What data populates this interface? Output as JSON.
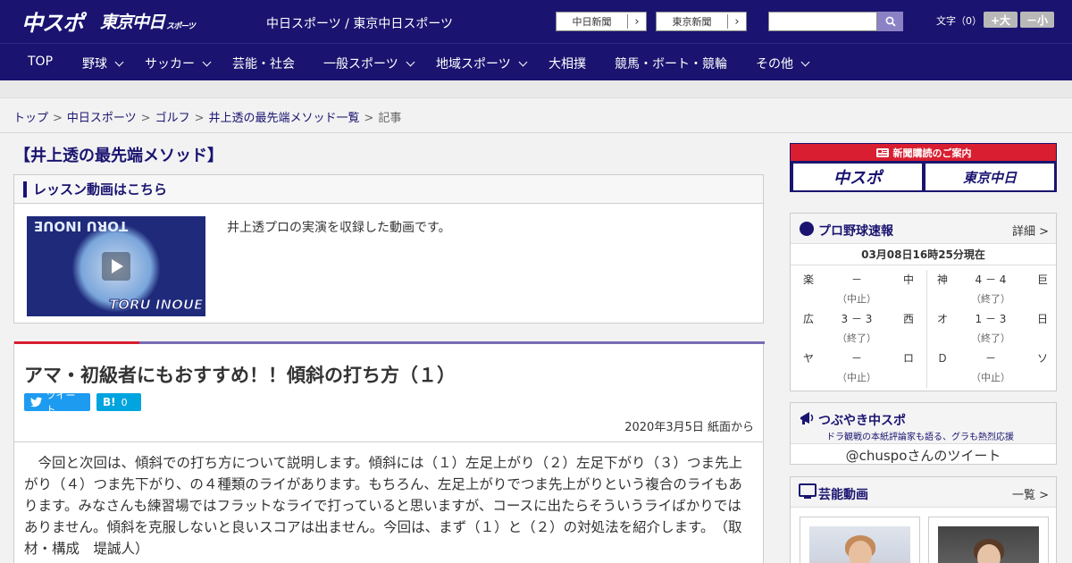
{
  "header": {
    "logo_chuspo": "中スポ",
    "logo_tokyo": "東京中日",
    "logo_tokyo_sub": "スポーツ",
    "site_title": "中日スポーツ / 東京中日スポーツ",
    "link_chunichi": "中日新聞",
    "link_tokyo": "東京新聞",
    "font_label": "文字（0）",
    "font_up": "+大",
    "font_down": "－小",
    "search_placeholder": ""
  },
  "nav": [
    "TOP",
    "野球",
    "サッカー",
    "芸能・社会",
    "一般スポーツ",
    "地域スポーツ",
    "大相撲",
    "競馬・ボート・競輪",
    "その他"
  ],
  "breadcrumb": [
    "トップ",
    "中日スポーツ",
    "ゴルフ",
    "井上透の最先端メソッド一覧",
    "記事"
  ],
  "series_title": "【井上透の最先端メソッド】",
  "video": {
    "heading": "レッスン動画はこちら",
    "thumb_text": "TORU INOUE",
    "description": "井上透プロの実演を収録した動画です。"
  },
  "article": {
    "title": "アマ・初級者にもおすすめ！！傾斜の打ち方（１）",
    "tweet_label": "ツイート",
    "hatena_label": "B!",
    "hatena_count": "0",
    "date": "2020年3月5日 紙面から",
    "body": "今回と次回は、傾斜での打ち方について説明します。傾斜には（１）左足上がり（２）左足下がり（３）つま先上がり（４）つま先下がり、の４種類のライがあります。もちろん、左足上がりでつま先上がりという複合のライもあります。みなさんも練習場ではフラットなライで打っていると思いますが、コースに出たらそういうライばかりではありません。傾斜を克服しないと良いスコアは出ません。今回は、まず（１）と（２）の対処法を紹介します。　（取材・構成　堤誠人）"
  },
  "sidebar": {
    "subscribe_head": "新聞購読のご案内",
    "sub_chuspo": "中スポ",
    "sub_tokyo": "東京中日",
    "baseball": {
      "title": "プロ野球速報",
      "more": "詳細 >",
      "time": "03月08日16時25分現在",
      "games": [
        {
          "home": "楽",
          "score": "－",
          "away": "中",
          "status": "（中止）"
        },
        {
          "home": "広",
          "score": "3 － 3",
          "away": "西",
          "status": "（終了）"
        },
        {
          "home": "ヤ",
          "score": "－",
          "away": "ロ",
          "status": "（中止）"
        },
        {
          "home": "神",
          "score": "4 － 4",
          "away": "巨",
          "status": "（終了）"
        },
        {
          "home": "オ",
          "score": "1 － 3",
          "away": "日",
          "status": "（終了）"
        },
        {
          "home": "Ｄ",
          "score": "－",
          "away": "ソ",
          "status": "（中止）"
        }
      ]
    },
    "tsubuyaki": {
      "title": "つぶやき中スポ",
      "sub": "ドラ観戦の本紙評論家も語る、グラも熱烈応援",
      "handle": "@chuspoさんのツイート"
    },
    "geino": {
      "title": "芸能動画",
      "more": "一覧 >"
    }
  },
  "colors": {
    "brand_navy": "#1a1470",
    "accent_red": "#d81e30",
    "accent_purple": "#7a6bb5"
  }
}
